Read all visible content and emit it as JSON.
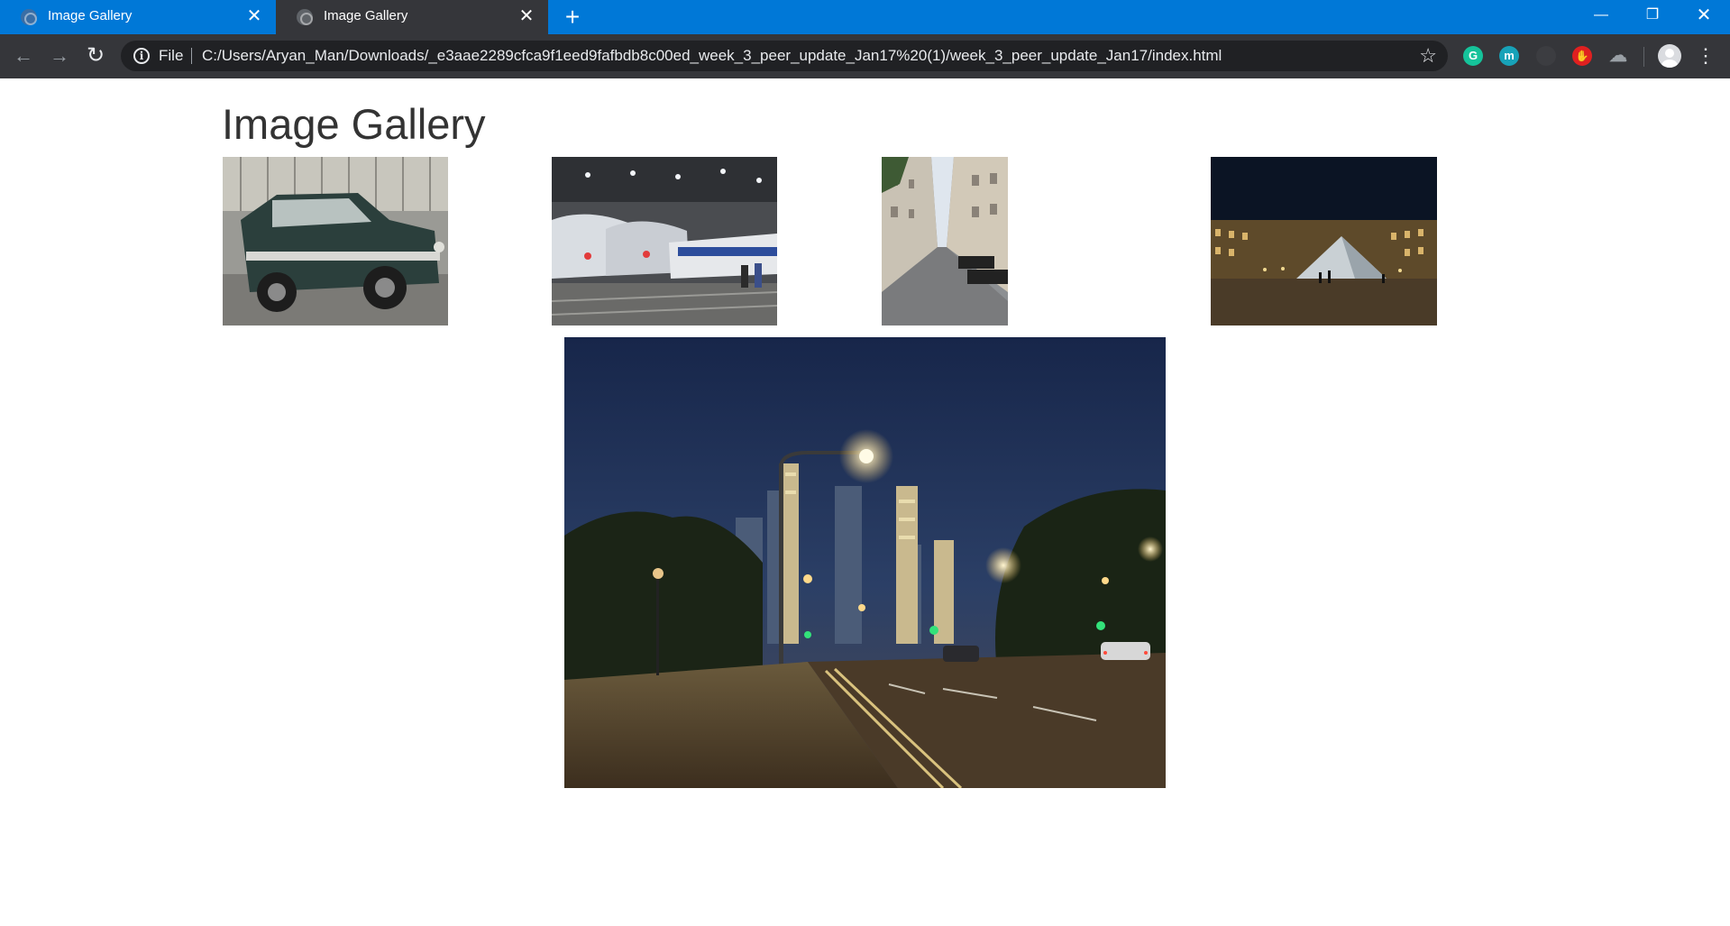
{
  "tabs": [
    {
      "title": "Image Gallery",
      "favicon": "globe-icon",
      "active": false
    },
    {
      "title": "Image Gallery",
      "favicon": "globe-icon",
      "active": true
    }
  ],
  "toolbar": {
    "scheme": "File",
    "url": "C:/Users/Aryan_Man/Downloads/_e3aae2289cfca9f1eed9fafbdb8c00ed_week_3_peer_update_Jan17%20(1)/week_3_peer_update_Jan17/index.html",
    "extensions": {
      "grammarly": "G",
      "m": "m"
    }
  },
  "page": {
    "title": "Image Gallery"
  },
  "colors": {
    "tabstrip": "#0078d7",
    "toolbar": "#35363a",
    "omnibox": "#202124",
    "title_text": "#333333"
  }
}
